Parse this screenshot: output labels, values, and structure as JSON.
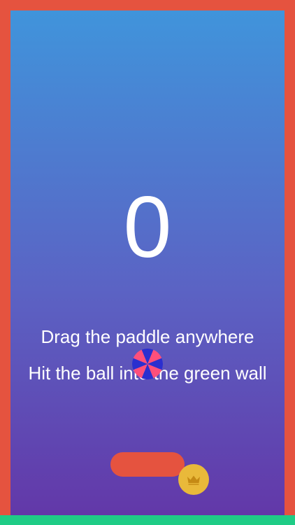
{
  "game": {
    "score": "0",
    "instructions": {
      "line1": "Drag the paddle anywhere",
      "line2": "Hit the ball into the green wall"
    }
  },
  "colors": {
    "wall_red": "#e5533f",
    "wall_green": "#1fcc86",
    "paddle": "#e5533f",
    "crown_button_bg": "#e9b93a",
    "crown_icon": "#c58a14",
    "ball_stripe_a": "#2b2fcf",
    "ball_stripe_b": "#ff4f7b",
    "background_top": "#3f96dc",
    "background_bottom": "#6336a7"
  },
  "icons": {
    "crown_button": "crown-icon",
    "ball": "striped-ball-icon"
  }
}
